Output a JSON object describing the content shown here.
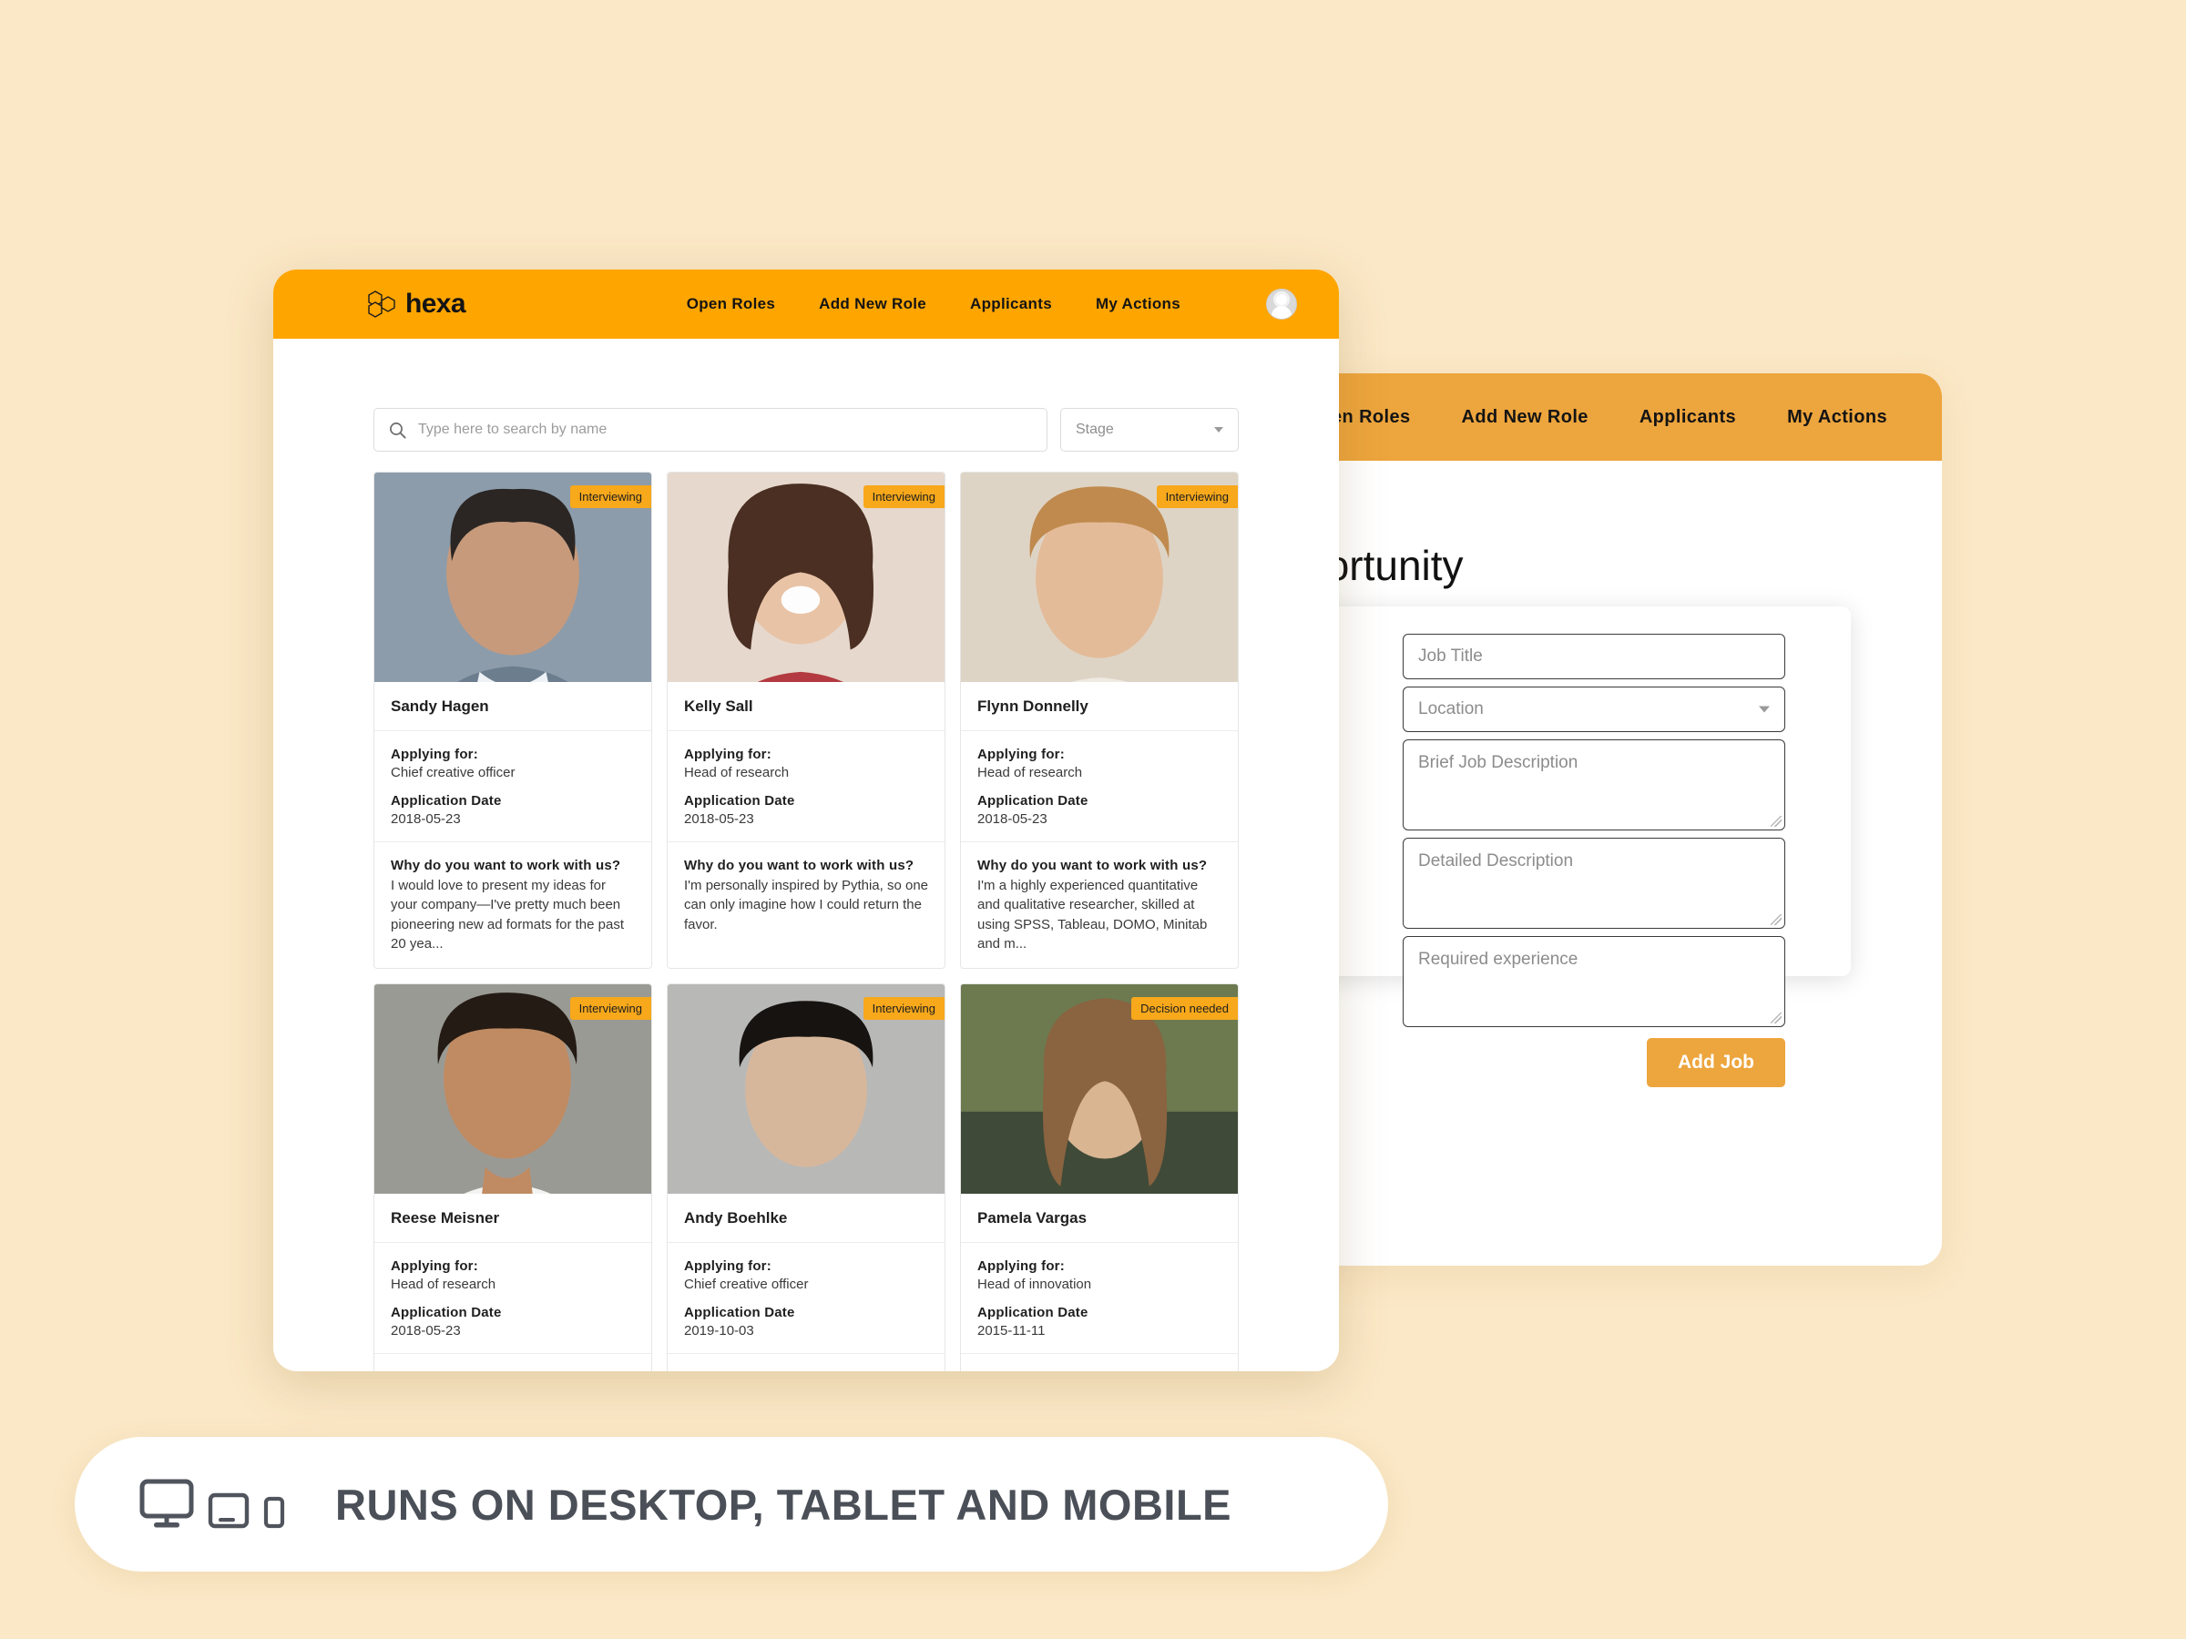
{
  "theme": {
    "page_background": "#fbe8c6",
    "primary_orange": "#ffa500",
    "muted_orange": "#eda53d",
    "badge_orange": "#f7a81b",
    "banner_text_color": "#4b4f57"
  },
  "front_window": {
    "brand": {
      "wordmark": "hexa",
      "logo_icon": "hexagon-cluster-icon"
    },
    "nav": [
      {
        "label": "Open Roles"
      },
      {
        "label": "Add New Role"
      },
      {
        "label": "Applicants"
      },
      {
        "label": "My Actions"
      }
    ],
    "avatar": {
      "icon": "user-avatar-icon"
    },
    "search": {
      "icon": "search-icon",
      "placeholder": "Type here to search by name",
      "value": ""
    },
    "stage_filter": {
      "label": "Stage",
      "icon": "chevron-down-icon"
    },
    "card_labels": {
      "applying_for": "Applying for:",
      "application_date": "Application Date",
      "why_work": "Why do you want to work with us?"
    },
    "applicants": [
      {
        "name": "Sandy Hagen",
        "status": "Interviewing",
        "role": "Chief creative officer",
        "date": "2018-05-23",
        "quote": "I would love to present my ideas for your company—I've pretty much been pioneering new ad formats for the past 20 yea...",
        "photo_colors": [
          "#8c9cab",
          "#6c7d8e",
          "#c79a7c"
        ]
      },
      {
        "name": "Kelly Sall",
        "status": "Interviewing",
        "role": "Head of research",
        "date": "2018-05-23",
        "quote": "I'm personally inspired by Pythia, so one can only imagine how I could return the favor.",
        "photo_colors": [
          "#e6d8cd",
          "#b33a40",
          "#7c4a3a"
        ]
      },
      {
        "name": "Flynn Donnelly",
        "status": "Interviewing",
        "role": "Head of research",
        "date": "2018-05-23",
        "quote": "I'm a highly experienced quantitative and qualitative researcher, skilled at using SPSS, Tableau, DOMO, Minitab and m...",
        "photo_colors": [
          "#d9cfc0",
          "#c9a070",
          "#e8ddcf"
        ]
      },
      {
        "name": "Reese Meisner",
        "status": "Interviewing",
        "role": "Head of research",
        "date": "2018-05-23",
        "quote": "",
        "photo_colors": [
          "#9a9a95",
          "#7c6a5c",
          "#cfa488"
        ]
      },
      {
        "name": "Andy Boehlke",
        "status": "Interviewing",
        "role": "Chief creative officer",
        "date": "2019-10-03",
        "quote": "",
        "photo_colors": [
          "#b8b8b6",
          "#8f8f8d",
          "#d7b79c"
        ]
      },
      {
        "name": "Pamela Vargas",
        "status": "Decision needed",
        "role": "Head of innovation",
        "date": "2015-11-11",
        "quote": "",
        "photo_colors": [
          "#3f4a38",
          "#6d7a4f",
          "#d9b592"
        ]
      }
    ]
  },
  "back_window": {
    "nav": [
      {
        "label": "Open Roles"
      },
      {
        "label": "Add New Role"
      },
      {
        "label": "Applicants"
      },
      {
        "label": "My Actions"
      }
    ],
    "title": "New Job Opportunity",
    "form": {
      "job_title_placeholder": "Job Title",
      "location_placeholder": "Location",
      "location_icon": "chevron-down-icon",
      "brief_description_placeholder": "Brief Job Description",
      "detailed_description_placeholder": "Detailed Description",
      "required_experience_placeholder": "Required experience",
      "submit_label": "Add Job"
    }
  },
  "banner": {
    "caption": "RUNS ON DESKTOP, TABLET AND MOBILE",
    "icons": [
      {
        "name": "desktop-monitor-icon"
      },
      {
        "name": "tablet-icon"
      },
      {
        "name": "mobile-phone-icon"
      }
    ]
  }
}
